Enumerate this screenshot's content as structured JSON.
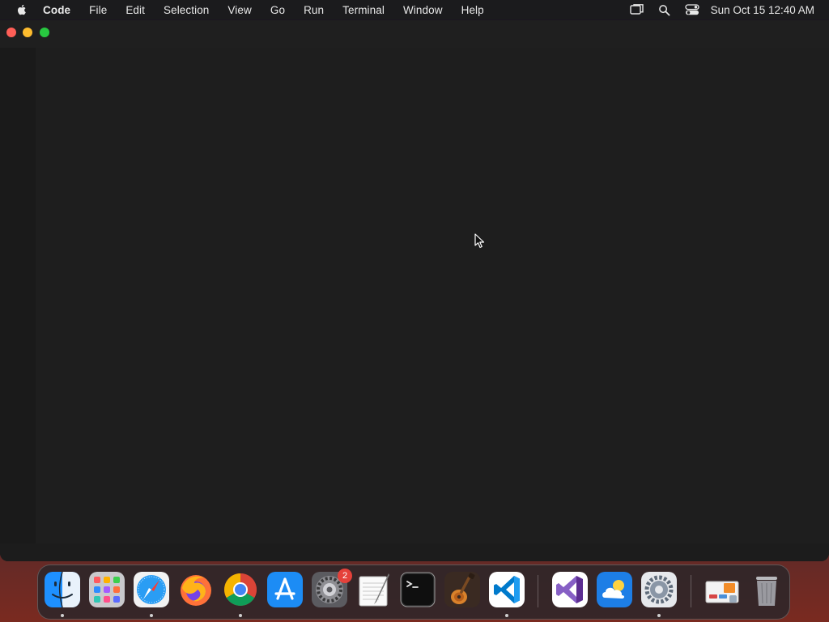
{
  "menubar": {
    "app_name": "Code",
    "items": [
      "File",
      "Edit",
      "Selection",
      "View",
      "Go",
      "Run",
      "Terminal",
      "Window",
      "Help"
    ],
    "status_icons": [
      "screen-mirroring-icon",
      "search-icon",
      "control-center-icon"
    ],
    "clock": "Sun Oct 15  12:40 AM"
  },
  "window": {
    "title": "",
    "traffic_lights": [
      "close",
      "minimize",
      "zoom"
    ],
    "colors": {
      "close": "#ff5f57",
      "minimize": "#febc2e",
      "zoom": "#28c840",
      "editor_bg": "#1e1e1e"
    }
  },
  "dock": {
    "apps": [
      {
        "name": "Finder",
        "icon": "finder-icon",
        "running": true
      },
      {
        "name": "Launchpad",
        "icon": "launchpad-icon",
        "running": false
      },
      {
        "name": "Safari",
        "icon": "safari-icon",
        "running": true
      },
      {
        "name": "Firefox",
        "icon": "firefox-icon",
        "running": false
      },
      {
        "name": "Google Chrome",
        "icon": "chrome-icon",
        "running": true
      },
      {
        "name": "App Store",
        "icon": "app-store-icon",
        "running": false
      },
      {
        "name": "System Preferences",
        "icon": "system-preferences-icon",
        "running": false,
        "badge": "2"
      },
      {
        "name": "TextEdit",
        "icon": "textedit-icon",
        "running": false
      },
      {
        "name": "Terminal",
        "icon": "terminal-icon",
        "running": false
      },
      {
        "name": "GarageBand",
        "icon": "garageband-icon",
        "running": false
      },
      {
        "name": "Visual Studio Code",
        "icon": "vscode-icon",
        "running": true
      },
      {
        "name": "Visual Studio",
        "icon": "visual-studio-icon",
        "running": false
      },
      {
        "name": "Weather",
        "icon": "weather-icon",
        "running": false
      },
      {
        "name": "Settings",
        "icon": "settings-gear-icon",
        "running": true
      },
      {
        "name": "Documents",
        "icon": "documents-stack-icon",
        "running": false
      },
      {
        "name": "Trash",
        "icon": "trash-icon",
        "running": false
      }
    ]
  }
}
